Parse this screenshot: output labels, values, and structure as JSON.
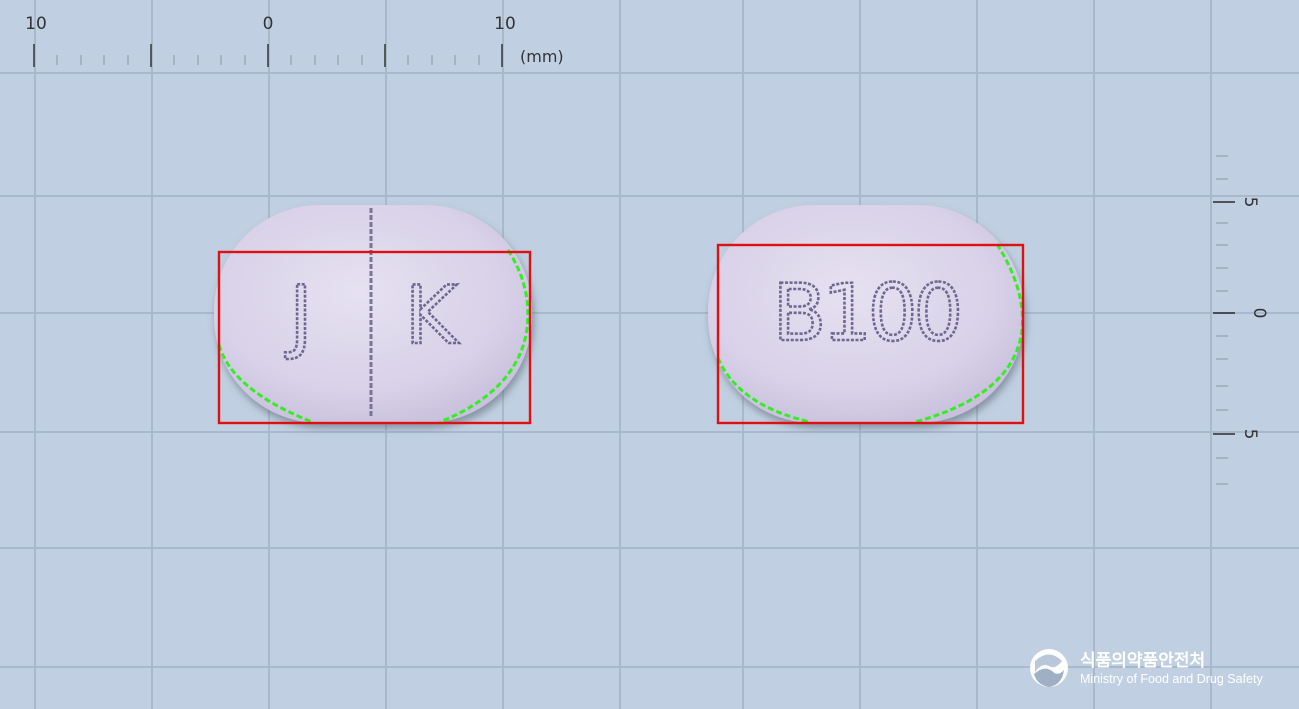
{
  "ruler_top": {
    "labels": [
      "10",
      "0",
      "10"
    ],
    "unit": "(mm)"
  },
  "ruler_right": {
    "labels": [
      "5",
      "0",
      "5"
    ]
  },
  "tablets": [
    {
      "name": "tablet-front",
      "imprint_left": "J",
      "imprint_right": "K",
      "score_line": true
    },
    {
      "name": "tablet-back",
      "imprint": "B100"
    }
  ],
  "colors": {
    "background": "#c0d0e2",
    "tablet": "#dcd6ea",
    "imprint": "#6d6791",
    "detection_box": "#e01010",
    "contour": "#33ee22"
  },
  "logo": {
    "icon": "mfds-emblem-icon",
    "korean": "식품의약품안전처",
    "english": "Ministry of Food and Drug Safety"
  }
}
